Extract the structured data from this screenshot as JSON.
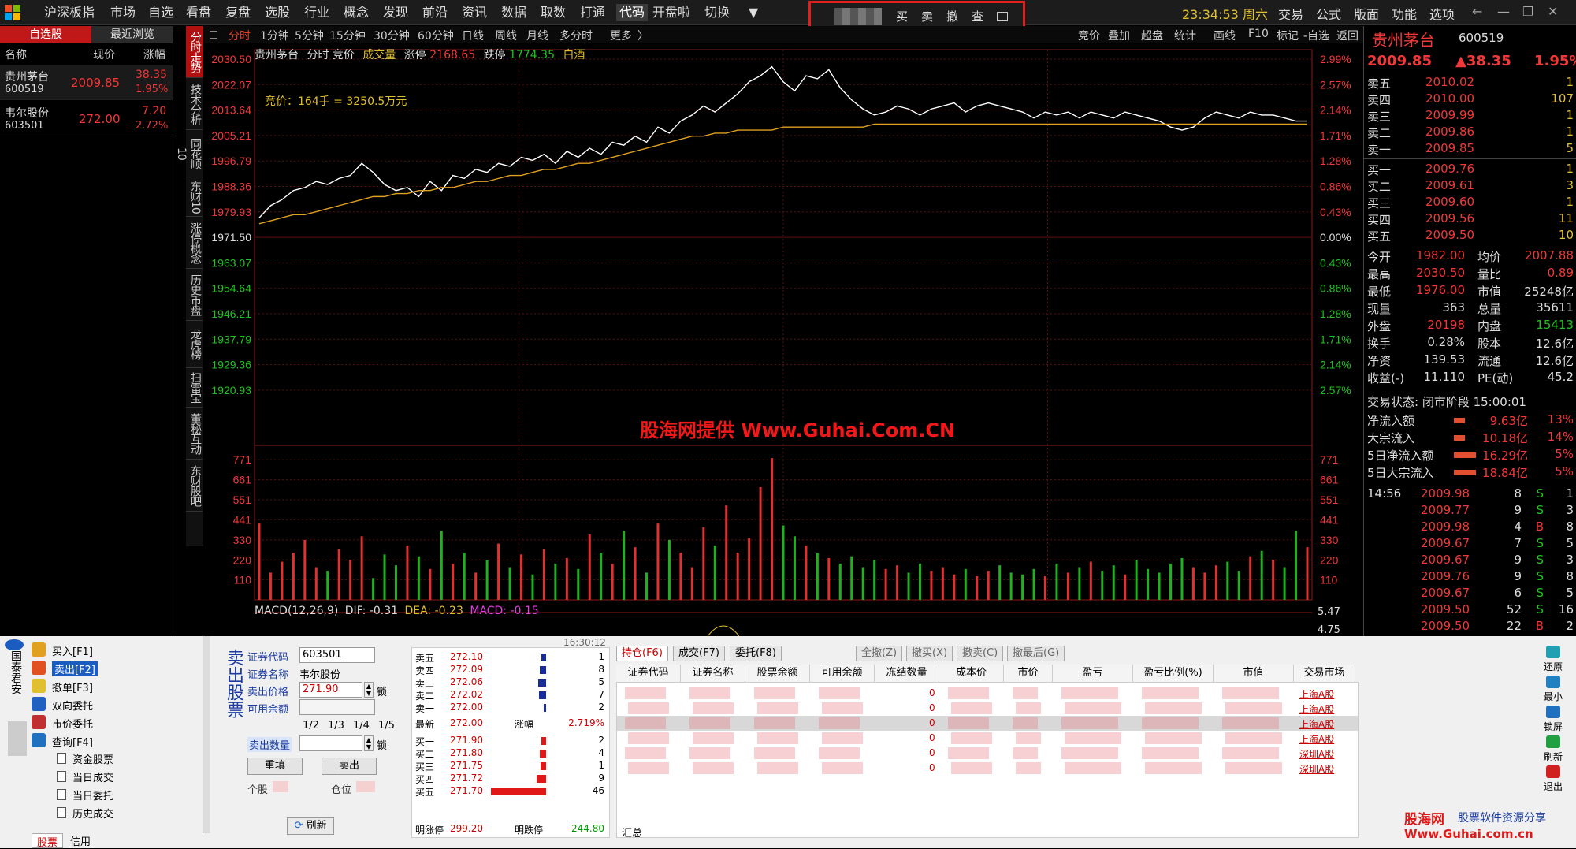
{
  "menubar": {
    "items": [
      "沪深",
      "板指",
      "市场",
      "自选",
      "看盘",
      "复盘",
      "选股",
      "行业",
      "概念",
      "发现",
      "前沿",
      "资讯",
      "数据",
      "取数",
      "打通",
      "代码",
      "开盘啦",
      "切换"
    ],
    "active_index": 15,
    "trade_buttons": [
      "买",
      "卖",
      "撤",
      "查"
    ],
    "clock": "23:34:53 周六",
    "right_items": [
      "交易",
      "公式",
      "版面",
      "功能",
      "选项"
    ]
  },
  "watchlist": {
    "tabs": [
      "自选股",
      "最近浏览"
    ],
    "headers": [
      "名称",
      "现价",
      "涨幅"
    ],
    "stocks": [
      {
        "name": "贵州茅台",
        "code": "600519",
        "price": "2009.85",
        "change": "38.35",
        "pct": "1.95%"
      },
      {
        "name": "韦尔股份",
        "code": "603501",
        "price": "272.00",
        "change": "7.20",
        "pct": "2.72%"
      }
    ]
  },
  "vertical_tabs": [
    "分时走势",
    "技术分析",
    "同花顺10",
    "东财10",
    "涨停概念",
    "历史币盘",
    "龙虎榜",
    "扫雷宝",
    "董秘互动",
    "东财股吧"
  ],
  "period_bar": {
    "items": [
      "分时",
      "1分钟",
      "5分钟",
      "15分钟",
      "30分钟",
      "60分钟",
      "日线",
      "周线",
      "月线",
      "多分时",
      "更多"
    ],
    "right_items": [
      "竞价",
      "叠加",
      "超盘",
      "统计",
      "画线",
      "F10",
      "标记",
      "-自选",
      "返回"
    ]
  },
  "chart_header": {
    "stock": "贵州茅台",
    "label": "分时 竞价",
    "vol_label": "成交量",
    "limit_up_label": "涨停",
    "limit_up": "2168.65",
    "limit_down_label": "跌停",
    "limit_down": "1774.35",
    "sector": "白酒"
  },
  "auction_note": "竞价：164手 = 3250.5万元",
  "macd_label": {
    "name": "MACD(12,26,9)",
    "dif": "DIF: -0.31",
    "dea": "DEA: -0.23",
    "macd": "MACD: -0.15",
    "right1": "5.47",
    "right2": "4.75"
  },
  "watermark": "股海网提供 Www.Guhai.Com.CN",
  "chart_data": {
    "type": "line",
    "price_ticks": [
      "2030.50",
      "2022.07",
      "2013.64",
      "2005.21",
      "1996.79",
      "1988.36",
      "1979.93",
      "1971.50",
      "1963.07",
      "1954.64",
      "1946.21",
      "1937.79",
      "1929.36",
      "1920.93"
    ],
    "pct_ticks": [
      "2.99%",
      "2.57%",
      "2.14%",
      "1.71%",
      "1.28%",
      "0.86%",
      "0.43%",
      "0.00%",
      "0.43%",
      "0.86%",
      "1.28%",
      "1.71%",
      "2.14%",
      "2.57%"
    ],
    "vol_ticks": [
      "771",
      "661",
      "551",
      "441",
      "330",
      "220",
      "110"
    ],
    "ylim": [
      1912.5,
      2030.5
    ],
    "price": [
      1978,
      1982,
      1984,
      1987,
      1988,
      1990,
      1989,
      1991,
      1992,
      1996,
      1993,
      1989,
      1987,
      1988,
      1985,
      1990,
      1987,
      1992,
      1991,
      1994,
      1993,
      1996,
      1995,
      1998,
      1997,
      1999,
      1996,
      2000,
      1998,
      2001,
      1999,
      2003,
      2002,
      2005,
      2003,
      2008,
      2006,
      2010,
      2012,
      2015,
      2013,
      2016,
      2019,
      2023,
      2025,
      2028,
      2023,
      2020,
      2025,
      2024,
      2027,
      2021,
      2017,
      2014,
      2012,
      2013,
      2015,
      2014,
      2012,
      2014,
      2015,
      2016,
      2013,
      2015,
      2016,
      2015,
      2014,
      2013,
      2011,
      2013,
      2012,
      2013,
      2011,
      2013,
      2012,
      2011,
      2013,
      2012,
      2011,
      2010,
      2008,
      2007,
      2008,
      2011,
      2013,
      2012,
      2011,
      2013,
      2012,
      2012,
      2011,
      2010,
      2010
    ],
    "avg": [
      1976,
      1977,
      1978,
      1979,
      1979,
      1980,
      1981,
      1982,
      1983,
      1984,
      1985,
      1985,
      1986,
      1986,
      1987,
      1987,
      1988,
      1988,
      1989,
      1990,
      1990,
      1991,
      1992,
      1992,
      1993,
      1994,
      1994,
      1995,
      1996,
      1996,
      1997,
      1998,
      1999,
      2000,
      2001,
      2002,
      2003,
      2004,
      2005,
      2005,
      2006,
      2006,
      2007,
      2007,
      2007,
      2007,
      2008,
      2008,
      2008,
      2008,
      2008,
      2008,
      2008,
      2008,
      2009,
      2009,
      2009,
      2009,
      2009,
      2009,
      2009,
      2009,
      2009,
      2009,
      2009,
      2009,
      2009,
      2009,
      2009,
      2009,
      2009,
      2009,
      2009,
      2009,
      2009,
      2009,
      2009,
      2009,
      2009,
      2009,
      2009,
      2009,
      2009,
      2009,
      2009,
      2009,
      2009,
      2009,
      2009,
      2009,
      2009,
      2009,
      2009
    ],
    "volume": [
      420,
      150,
      210,
      260,
      330,
      180,
      160,
      280,
      220,
      350,
      120,
      250,
      190,
      300,
      240,
      170,
      380,
      200,
      260,
      150,
      220,
      310,
      180,
      250,
      140,
      280,
      200,
      230,
      170,
      360,
      260,
      200,
      380,
      290,
      150,
      420,
      330,
      260,
      180,
      400,
      300,
      520,
      260,
      340,
      620,
      780,
      410,
      350,
      300,
      260,
      230,
      200,
      240,
      180,
      220,
      170,
      190,
      150,
      200,
      160,
      180,
      140,
      170,
      130,
      160,
      190,
      150,
      140,
      170,
      130,
      200,
      150,
      180,
      210,
      160,
      190,
      140,
      220,
      170,
      150,
      200,
      230,
      180,
      150,
      190,
      210,
      160,
      240,
      270,
      220,
      180,
      380,
      290
    ]
  },
  "quote": {
    "name": "贵州茅台",
    "code": "600519",
    "price": "2009.85",
    "change": "▲38.35",
    "pct": "1.95%",
    "asks": [
      [
        "卖五",
        "2010.02",
        "1"
      ],
      [
        "卖四",
        "2010.00",
        "107"
      ],
      [
        "卖三",
        "2009.99",
        "1"
      ],
      [
        "卖二",
        "2009.86",
        "1"
      ],
      [
        "卖一",
        "2009.85",
        "5"
      ]
    ],
    "bids": [
      [
        "买一",
        "2009.76",
        "1"
      ],
      [
        "买二",
        "2009.61",
        "3"
      ],
      [
        "买三",
        "2009.60",
        "1"
      ],
      [
        "买四",
        "2009.56",
        "11"
      ],
      [
        "买五",
        "2009.50",
        "10"
      ]
    ],
    "stats": [
      [
        "今开",
        "1982.00",
        "均价",
        "2007.88"
      ],
      [
        "最高",
        "2030.50",
        "量比",
        "0.89"
      ],
      [
        "最低",
        "1976.00",
        "市值",
        "25248亿"
      ],
      [
        "现量",
        "363",
        "总量",
        "35611"
      ],
      [
        "外盘",
        "20198",
        "内盘",
        "15413"
      ],
      [
        "换手",
        "0.28%",
        "股本",
        "12.6亿"
      ],
      [
        "净资",
        "139.53",
        "流通",
        "12.6亿"
      ],
      [
        "收益(-)",
        "11.110",
        "PE(动)",
        "45.2"
      ]
    ],
    "status": "交易状态: 闭市阶段 15:00:01",
    "flows": [
      [
        "净流入额",
        "9.63亿",
        "13%"
      ],
      [
        "大宗流入",
        "10.18亿",
        "14%"
      ],
      [
        "5日净流入额",
        "16.29亿",
        "5%"
      ],
      [
        "5日大宗流入",
        "18.84亿",
        "5%"
      ]
    ],
    "ticks": [
      [
        "14:56",
        "2009.98",
        "8",
        "S",
        "1"
      ],
      [
        "",
        "2009.77",
        "9",
        "S",
        "3"
      ],
      [
        "",
        "2009.98",
        "4",
        "B",
        "8"
      ],
      [
        "",
        "2009.67",
        "7",
        "S",
        "5"
      ],
      [
        "",
        "2009.67",
        "9",
        "S",
        "3"
      ],
      [
        "",
        "2009.76",
        "9",
        "S",
        "8"
      ],
      [
        "",
        "2009.67",
        "6",
        "S",
        "5"
      ],
      [
        "",
        "2009.50",
        "52",
        "S",
        "16"
      ],
      [
        "",
        "2009.50",
        "22",
        "B",
        "2"
      ]
    ]
  },
  "trade": {
    "broker": "国泰君安",
    "menu": [
      "买入[F1]",
      "卖出[F2]",
      "撤单[F3]",
      "双向委托",
      "市价委托",
      "查询[F4]"
    ],
    "submenu": [
      "资金股票",
      "当日成交",
      "当日委托",
      "历史成交"
    ],
    "bottom_tabs": [
      "股票",
      "信用"
    ],
    "form_title": "卖出股票",
    "code_label": "证券代码",
    "code": "603501",
    "name_label": "证券名称",
    "name": "韦尔股份",
    "price_label": "卖出价格",
    "price": "271.90",
    "avail_label": "可用余额",
    "fractions": [
      "1/2",
      "1/3",
      "1/4",
      "1/5"
    ],
    "qty_label": "卖出数量",
    "lock": "锁",
    "reset": "重填",
    "sell": "卖出",
    "shares_label": "个股",
    "position_label": "仓位",
    "refresh": "刷新",
    "time": "16:30:12",
    "asks": [
      [
        "卖五",
        "272.10",
        "1"
      ],
      [
        "卖四",
        "272.09",
        "8"
      ],
      [
        "卖三",
        "272.06",
        "5"
      ],
      [
        "卖二",
        "272.02",
        "7"
      ],
      [
        "卖一",
        "272.00",
        "2"
      ]
    ],
    "last_label": "最新",
    "last": "272.00",
    "pct_label": "涨幅",
    "pct": "2.719%",
    "bids": [
      [
        "买一",
        "271.90",
        "2"
      ],
      [
        "买二",
        "271.80",
        "4"
      ],
      [
        "买三",
        "271.75",
        "1"
      ],
      [
        "买四",
        "271.72",
        "9"
      ],
      [
        "买五",
        "271.70",
        "46"
      ]
    ],
    "limit_up_label": "明涨停",
    "limit_up": "299.20",
    "limit_down_label": "明跌停",
    "limit_down": "244.80",
    "tabs": [
      "持仓(F6)",
      "成交(F7)",
      "委托(F8)"
    ],
    "actions": [
      "全撤(Z)",
      "撤买(X)",
      "撤卖(C)",
      "撤最后(G)"
    ],
    "columns": [
      "证券代码",
      "证券名称",
      "股票余额",
      "可用余额",
      "冻结数量",
      "成本价",
      "市价",
      "盈亏",
      "盈亏比例(%)",
      "市值",
      "交易市场"
    ],
    "frozen": [
      "0",
      "0",
      "0",
      "0",
      "0",
      "0"
    ],
    "markets": [
      "上海A股",
      "上海A股",
      "上海A股",
      "上海A股",
      "深圳A股",
      "深圳A股"
    ],
    "total_label": "汇总",
    "side_buttons": [
      "还原",
      "最小",
      "锁屏",
      "刷新",
      "退出"
    ],
    "site_logo": "股海网",
    "site_slogan": "股票软件资源分享",
    "site_url": "Www.Guhai.com.cn"
  }
}
